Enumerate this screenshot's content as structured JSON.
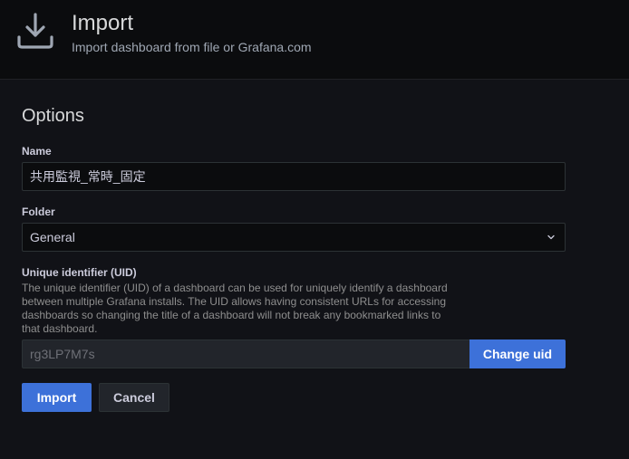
{
  "header": {
    "title": "Import",
    "subtitle": "Import dashboard from file or Grafana.com",
    "icon": "import-download-icon"
  },
  "options": {
    "section_title": "Options",
    "name_label": "Name",
    "name_value": "共用監視_常時_固定",
    "folder_label": "Folder",
    "folder_value": "General",
    "uid_label": "Unique identifier (UID)",
    "uid_description": "The unique identifier (UID) of a dashboard can be used for uniquely identify a dashboard between multiple Grafana installs. The UID allows having consistent URLs for accessing dashboards so changing the title of a dashboard will not break any bookmarked links to that dashboard.",
    "uid_value": "rg3LP7M7s",
    "change_uid_label": "Change uid"
  },
  "actions": {
    "import_label": "Import",
    "cancel_label": "Cancel"
  },
  "colors": {
    "accent": "#3d71d9",
    "background": "#111217",
    "header_bg": "#0b0c0e"
  }
}
